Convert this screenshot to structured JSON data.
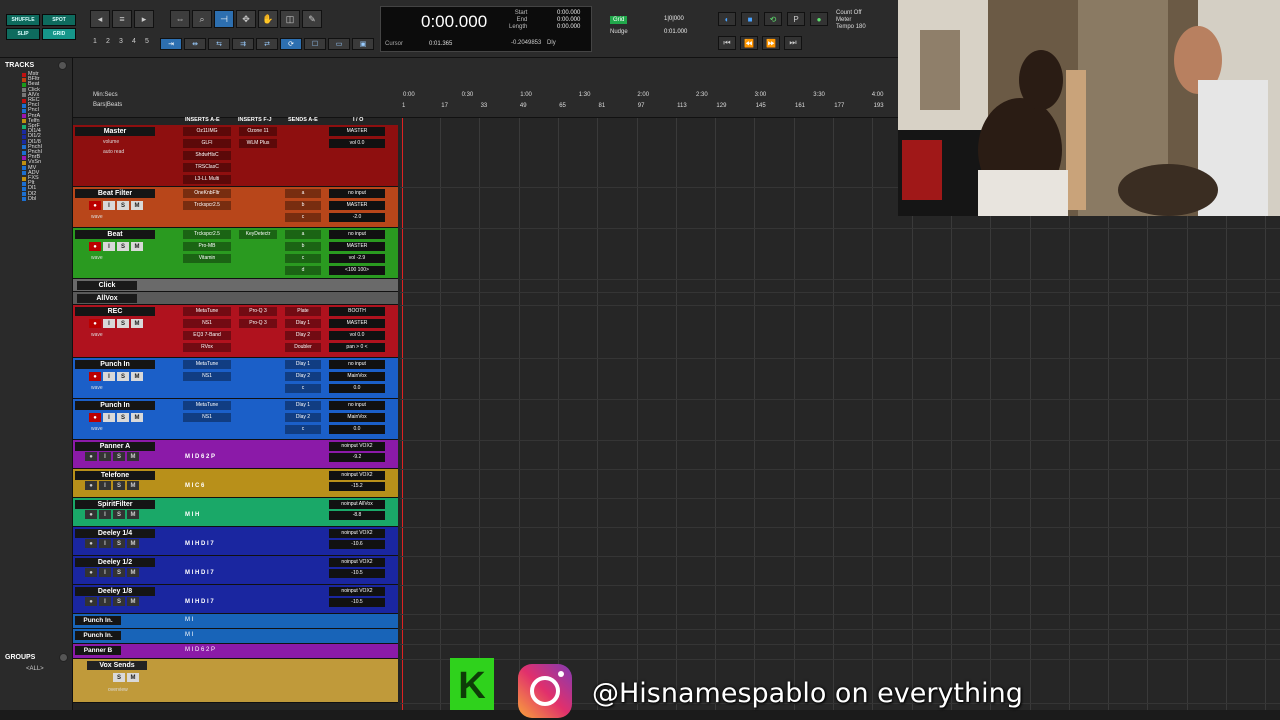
{
  "toolbar": {
    "modes": [
      "SHUFFLE",
      "SPOT",
      "SLIP",
      "GRID"
    ],
    "presets": [
      "1",
      "2",
      "3",
      "4",
      "5"
    ],
    "counter": {
      "main": "0:00.000",
      "cursor_label": "Cursor",
      "cursor_value": "0:01.365",
      "cursor_extra": "-0.2049853",
      "start_label": "Start",
      "end_label": "End",
      "length_label": "Length",
      "start_val": "0:00.000",
      "end_val": "0:00.000",
      "length_val": "0:00.000",
      "dly": "Dly"
    },
    "grid": {
      "label": "Grid",
      "value": "1|0|000",
      "nudge_label": "Nudge",
      "nudge_value": "0:01.000"
    },
    "countoff": [
      "Count Off",
      "Meter",
      "Tempo"
    ],
    "tempo_value": "180"
  },
  "sidebar": {
    "tracks_title": "TRACKS",
    "groups_title": "GROUPS",
    "all_group": "<ALL>",
    "items": [
      {
        "label": "Mstr",
        "color": "#c01010"
      },
      {
        "label": "BFltr",
        "color": "#c04010"
      },
      {
        "label": "Beat",
        "color": "#1a9a1a"
      },
      {
        "label": "Click",
        "color": "#777"
      },
      {
        "label": "AlVx",
        "color": "#777"
      },
      {
        "label": "REC",
        "color": "#c01010"
      },
      {
        "label": "PncI",
        "color": "#1c6fd0"
      },
      {
        "label": "PncI",
        "color": "#1c6fd0"
      },
      {
        "label": "PnrA",
        "color": "#9b16b0"
      },
      {
        "label": "Telfn",
        "color": "#c09010"
      },
      {
        "label": "SprF",
        "color": "#1ab070"
      },
      {
        "label": "Dl1/4",
        "color": "#1a2aa0"
      },
      {
        "label": "Dl1/2",
        "color": "#1a2aa0"
      },
      {
        "label": "Dl1/8",
        "color": "#1a2aa0"
      },
      {
        "label": "PnchI",
        "color": "#1c6fd0"
      },
      {
        "label": "PnchI",
        "color": "#1c6fd0"
      },
      {
        "label": "PnrB",
        "color": "#9b16b0"
      },
      {
        "label": "VxSn",
        "color": "#c09010"
      },
      {
        "label": "MV",
        "color": "#1c6fd0"
      },
      {
        "label": "ADV",
        "color": "#1c6fd0"
      },
      {
        "label": "FXS",
        "color": "#c09010"
      },
      {
        "label": "Plt",
        "color": "#1c6fd0"
      },
      {
        "label": "Dl1",
        "color": "#1c6fd0"
      },
      {
        "label": "Dl2",
        "color": "#1c6fd0"
      },
      {
        "label": "Dbl",
        "color": "#1c6fd0"
      }
    ]
  },
  "edit": {
    "ruler_min": "Min:Secs",
    "ruler_bars": "Bars|Beats",
    "columns": {
      "inserts_ae": "INSERTS A-E",
      "inserts_fj": "INSERTS F-J",
      "sends_ae": "SENDS A-E",
      "io": "I / O"
    },
    "time_marks": [
      "0:00",
      "0:30",
      "1:00",
      "1:30",
      "2:00",
      "2:30",
      "3:00",
      "3:30",
      "4:00"
    ],
    "bar_marks": [
      "1",
      "17",
      "33",
      "49",
      "65",
      "81",
      "97",
      "113",
      "129",
      "145",
      "161",
      "177",
      "193"
    ]
  },
  "tracks": [
    {
      "name": "Master",
      "color": "#8e0f0f",
      "height": 62,
      "type": "master",
      "inserts": [
        "Oz11IMG",
        "GLFI",
        "ShdwHlsC",
        "TRSClasC",
        "L3-LL Multi"
      ],
      "inserts2": [
        "Ozone 11",
        "WLM Plus"
      ],
      "io": [
        "MASTER",
        "vol 0.0"
      ],
      "labels": [
        "volume",
        "auto read"
      ]
    },
    {
      "name": "Beat Filter",
      "color": "#b8461a",
      "height": 41,
      "type": "audio",
      "inserts": [
        "OneKnbFltr",
        "Trckspcr2.5"
      ],
      "sends": [
        "a",
        "b",
        "c"
      ],
      "io": [
        "no input",
        "MASTER",
        "-2.0"
      ]
    },
    {
      "name": "Beat",
      "color": "#2a9a20",
      "height": 51,
      "type": "audio",
      "inserts": [
        "Trckspcr2.5",
        "Pro-MB",
        "Vitamin"
      ],
      "inserts2": [
        "KeyDetectr"
      ],
      "sends": [
        "a",
        "b",
        "c",
        "d"
      ],
      "io": [
        "no input",
        "MASTER",
        "vol -2.9",
        "<100 100>"
      ]
    },
    {
      "name": "Click",
      "color": "#6a6a6a",
      "height": 13,
      "type": "mini"
    },
    {
      "name": "AllVox",
      "color": "#5a5a5a",
      "height": 13,
      "type": "mini"
    },
    {
      "name": "REC",
      "color": "#b0121e",
      "height": 53,
      "type": "audio",
      "inserts": [
        "MetaTune",
        "NS1",
        "EQ3 7-Band",
        "RVox"
      ],
      "inserts2": [
        "Pro-Q 3",
        "Pro-Q 3"
      ],
      "sends": [
        "Plate",
        "Dlay 1",
        "Dlay 2",
        "Doubler"
      ],
      "io": [
        "BOOTH",
        "MASTER",
        "vol 0.0",
        "pan > 0 <"
      ]
    },
    {
      "name": "Punch In",
      "color": "#1b5fc8",
      "height": 41,
      "type": "audio",
      "inserts": [
        "MetaTune",
        "NS1"
      ],
      "sends": [
        "Dlay 1",
        "Dlay 2",
        "c"
      ],
      "io": [
        "no input",
        "MainVox",
        "0.0"
      ]
    },
    {
      "name": "Punch In",
      "color": "#1b5fc8",
      "height": 41,
      "type": "audio",
      "inserts": [
        "MetaTune",
        "NS1"
      ],
      "sends": [
        "Dlay 1",
        "Dlay 2",
        "c"
      ],
      "io": [
        "no input",
        "MainVox",
        "0.0"
      ]
    },
    {
      "name": "Panner A",
      "color": "#8b1aa8",
      "height": 29,
      "type": "compact",
      "io": [
        "noinput VOX2",
        "-9.2"
      ],
      "strip": "M I D 6 2 P"
    },
    {
      "name": "Telefone",
      "color": "#b8901a",
      "height": 29,
      "type": "compact",
      "io": [
        "noinput VOX2",
        "-15.2"
      ],
      "strip": "M I C 6"
    },
    {
      "name": "SpiritFilter",
      "color": "#1aa868",
      "height": 29,
      "type": "compact",
      "io": [
        "noinput AllVox",
        "-8.8"
      ],
      "strip": "M I H"
    },
    {
      "name": "Deeley 1/4",
      "color": "#1a26a0",
      "height": 29,
      "type": "compact",
      "io": [
        "noinput VOX2",
        "-10.6"
      ],
      "strip": "M I H D I 7"
    },
    {
      "name": "Deeley 1/2",
      "color": "#1a26a0",
      "height": 29,
      "type": "compact",
      "io": [
        "noinput VOX2",
        "-10.5"
      ],
      "strip": "M I H D I 7"
    },
    {
      "name": "Deeley 1/8",
      "color": "#1a26a0",
      "height": 29,
      "type": "compact",
      "io": [
        "noinput VOX2",
        "-10.5"
      ],
      "strip": "M I H D I 7"
    },
    {
      "name": "Punch In.",
      "color": "#1864b8",
      "height": 15,
      "type": "compact1",
      "strip": "M I"
    },
    {
      "name": "Punch In.",
      "color": "#1864b8",
      "height": 15,
      "type": "compact1",
      "strip": "M I"
    },
    {
      "name": "Panner B",
      "color": "#8b1aa8",
      "height": 15,
      "type": "compact1",
      "strip": "M I D 6 2 P"
    },
    {
      "name": "Vox Sends",
      "color": "#c09a3a",
      "height": 44,
      "type": "folder",
      "labels": [
        "overview"
      ]
    }
  ],
  "overlay": {
    "handle": "@Hisnamespablo on everything",
    "k_letter": "K"
  }
}
